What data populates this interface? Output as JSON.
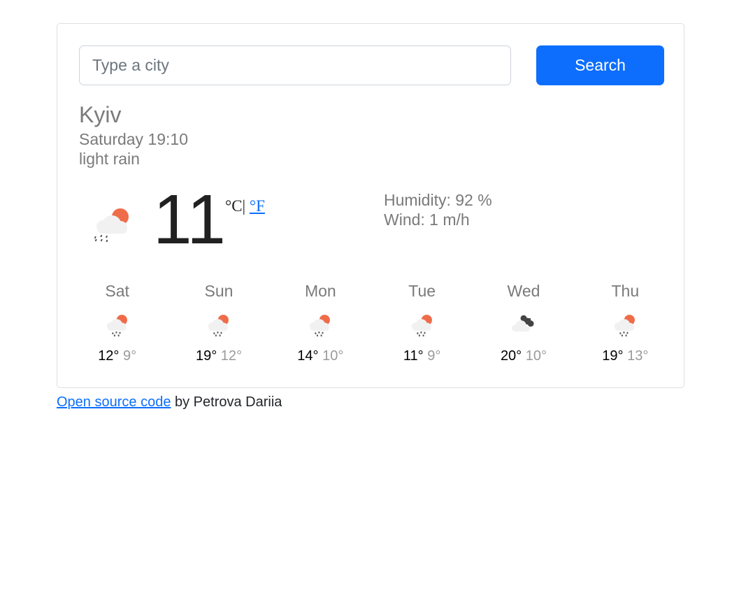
{
  "search": {
    "placeholder": "Type a city",
    "value": "",
    "button_label": "Search"
  },
  "current": {
    "city": "Kyiv",
    "datetime": "Saturday 19:10",
    "description": "light rain",
    "icon": "rain-sun-icon",
    "temperature": "11",
    "unit_celsius": "°C",
    "unit_separator": "|",
    "unit_fahrenheit": "°F",
    "humidity_label": "Humidity: 92 %",
    "wind_label": "Wind: 1 m/h"
  },
  "forecast": [
    {
      "day": "Sat",
      "icon": "rain-sun-icon",
      "max": "12°",
      "min": "9°"
    },
    {
      "day": "Sun",
      "icon": "rain-sun-icon",
      "max": "19°",
      "min": "12°"
    },
    {
      "day": "Mon",
      "icon": "rain-sun-icon",
      "max": "14°",
      "min": "10°"
    },
    {
      "day": "Tue",
      "icon": "rain-sun-icon",
      "max": "11°",
      "min": "9°"
    },
    {
      "day": "Wed",
      "icon": "broken-clouds-icon",
      "max": "20°",
      "min": "10°"
    },
    {
      "day": "Thu",
      "icon": "rain-sun-icon",
      "max": "19°",
      "min": "13°"
    }
  ],
  "footer": {
    "link_text": "Open source code",
    "author_text": " by Petrova Dariia"
  },
  "colors": {
    "accent": "#0d6efd",
    "sun": "#ef6c4b",
    "cloud": "#f1f1f1",
    "dark_cloud": "#444444"
  }
}
